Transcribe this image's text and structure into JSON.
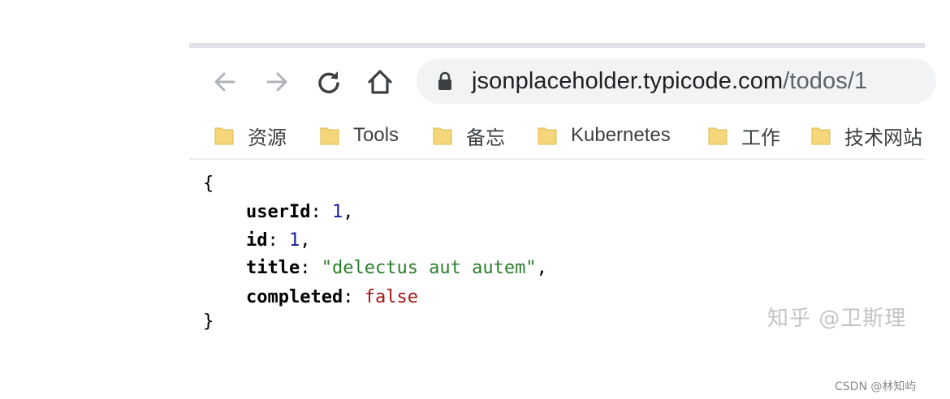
{
  "toolbar": {
    "icons": [
      "back-arrow-icon",
      "forward-arrow-icon",
      "reload-icon",
      "home-icon",
      "lock-icon"
    ],
    "url_host": "jsonplaceholder.typicode.com",
    "url_path": "/todos/1"
  },
  "bookmarks": [
    {
      "label": "资源",
      "icon": "folder-icon"
    },
    {
      "label": "Tools",
      "icon": "folder-icon"
    },
    {
      "label": "备忘",
      "icon": "folder-icon"
    },
    {
      "label": "Kubernetes",
      "icon": "folder-icon"
    },
    {
      "label": "工作",
      "icon": "folder-icon"
    },
    {
      "label": "技术网站",
      "icon": "folder-icon"
    }
  ],
  "json_view": {
    "open_brace": "{",
    "close_brace": "}",
    "entries": [
      {
        "key": "userId",
        "value": "1",
        "type": "number",
        "comma": ","
      },
      {
        "key": "id",
        "value": "1",
        "type": "number",
        "comma": ","
      },
      {
        "key": "title",
        "value": "\"delectus aut autem\"",
        "type": "string",
        "comma": ","
      },
      {
        "key": "completed",
        "value": "false",
        "type": "boolean",
        "comma": ""
      }
    ]
  },
  "watermark": "知乎 @卫斯理",
  "credit": "CSDN @林知屿",
  "colors": {
    "number": "#1a1aa6",
    "string": "#2a7e2a",
    "boolean": "#a31515",
    "folder": "#f6d67a"
  }
}
